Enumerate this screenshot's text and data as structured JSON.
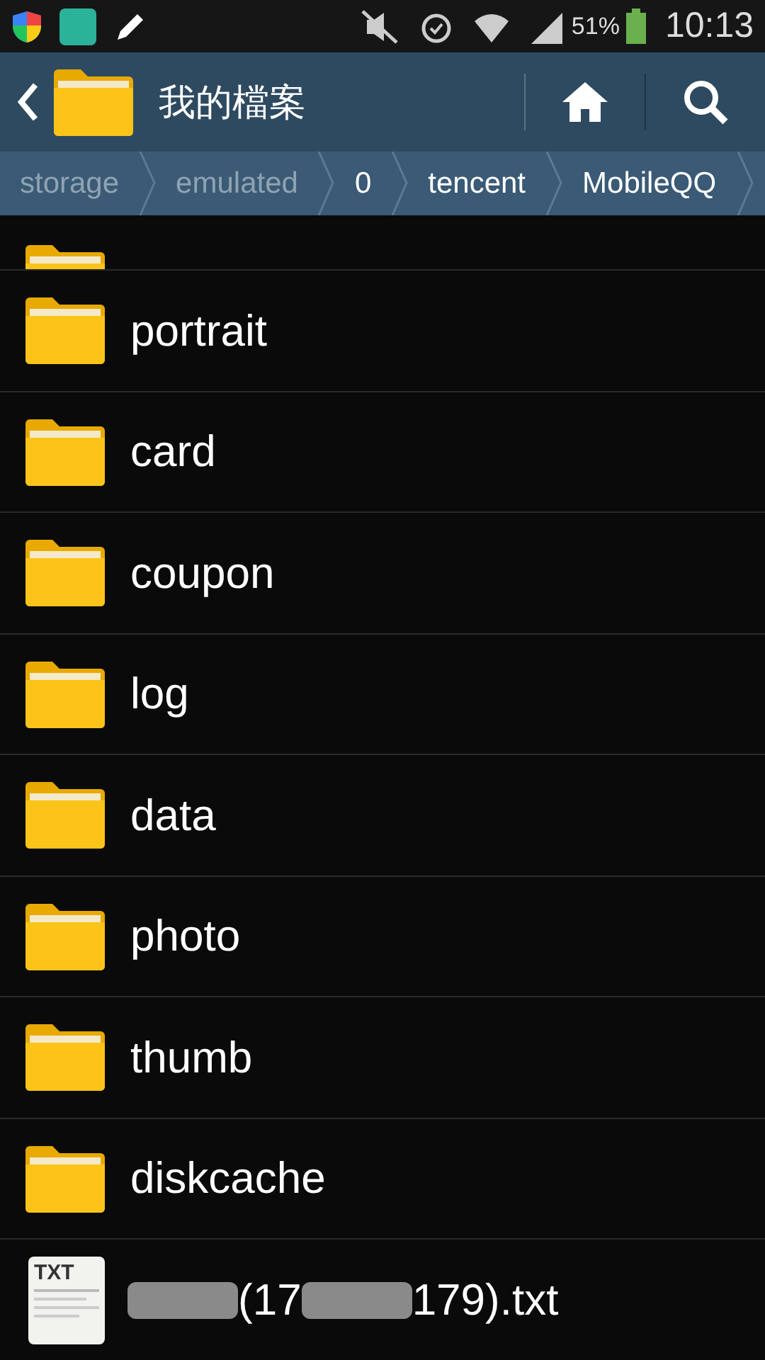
{
  "status_bar": {
    "battery": "51%",
    "time": "10:13"
  },
  "action_bar": {
    "title": "我的檔案"
  },
  "breadcrumb": [
    {
      "label": "storage",
      "selected": false
    },
    {
      "label": "emulated",
      "selected": false
    },
    {
      "label": "0",
      "selected": true
    },
    {
      "label": "tencent",
      "selected": true
    },
    {
      "label": "MobileQQ",
      "selected": true
    }
  ],
  "items": [
    {
      "kind": "folder"
    },
    {
      "kind": "folder",
      "name": "portrait"
    },
    {
      "kind": "folder",
      "name": "card"
    },
    {
      "kind": "folder",
      "name": "coupon"
    },
    {
      "kind": "folder",
      "name": "log"
    },
    {
      "kind": "folder",
      "name": "data"
    },
    {
      "kind": "folder",
      "name": "photo"
    },
    {
      "kind": "folder",
      "name": "thumb"
    },
    {
      "kind": "folder",
      "name": "diskcache"
    },
    {
      "kind": "txt",
      "icon_label": "TXT",
      "name_parts": [
        {
          "kind": "blur"
        },
        {
          "kind": "text",
          "text": "(17"
        },
        {
          "kind": "blur"
        },
        {
          "kind": "text",
          "text": "179).txt"
        }
      ]
    }
  ]
}
